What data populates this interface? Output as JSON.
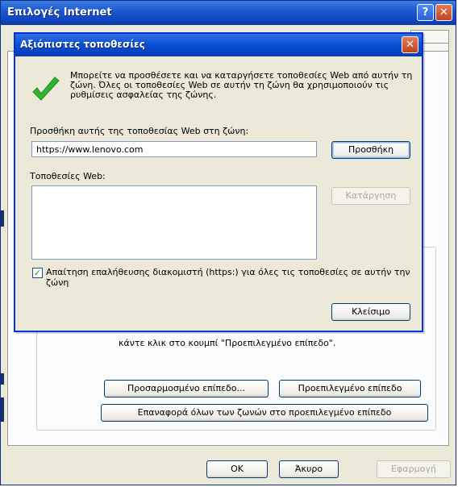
{
  "outer_window": {
    "title": "Επιλογές Internet",
    "help_glyph": "?",
    "close_glyph": "✕",
    "level_description": "κάντε κλικ στο κουμπί \"Προεπιλεγμένο επίπεδο\".",
    "custom_level_label": "Προσαρμοσμένο επίπεδο...",
    "default_level_label": "Προεπιλεγμένο επίπεδο",
    "reset_all_label": "Επαναφορά όλων των ζωνών στο προεπιλεγμένο επίπεδο",
    "ok_label": "OK",
    "cancel_label": "Άκυρο",
    "apply_label": "Εφαρμογή"
  },
  "dialog": {
    "title": "Αξιόπιστες τοποθεσίες",
    "close_glyph": "✕",
    "info_text": "Μπορείτε να προσθέσετε και να καταργήσετε τοποθεσίες Web από αυτήν τη ζώνη. Όλες οι τοποθεσίες Web σε αυτήν τη ζώνη θα χρησιμοποιούν τις ρυθμίσεις ασφαλείας της ζώνης.",
    "add_label": "Προσθήκη αυτής της τοποθεσίας Web στη ζώνη:",
    "add_value": "https://www.lenovo.com",
    "add_button": "Προσθήκη",
    "sites_label": "Τοποθεσίες Web:",
    "remove_button": "Κατάργηση",
    "require_https_label": "Απαίτηση επαλήθευσης διακομιστή (https:) για όλες τις τοποθεσίες σε αυτήν την ζώνη",
    "require_https_checked": true,
    "close_button": "Κλείσιμο"
  },
  "colors": {
    "titlebar": "#0a4fd1",
    "window_bg": "#ece9d8",
    "check_green": "#2fb42f"
  }
}
